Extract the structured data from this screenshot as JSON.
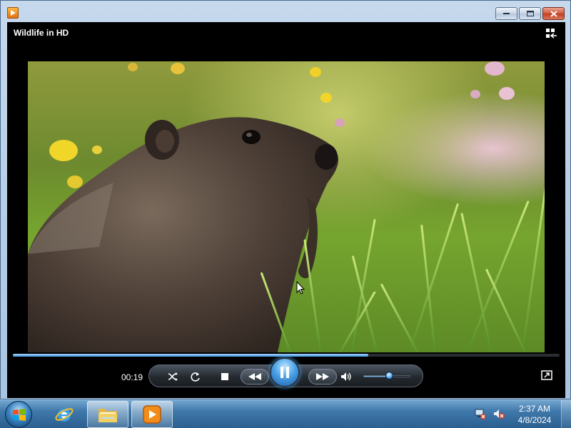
{
  "window": {
    "title": "Wildlife in HD",
    "minimize_icon": "minimize-icon",
    "maximize_icon": "maximize-icon",
    "close_icon": "close-icon"
  },
  "player": {
    "elapsed_time": "00:19",
    "seek_progress": 0.65,
    "volume_level": 0.55,
    "state": "playing",
    "buttons": {
      "shuffle": "shuffle-icon",
      "repeat": "repeat-icon",
      "stop": "stop-icon",
      "previous": "rewind-icon",
      "play_pause": "pause-icon",
      "next": "fast-forward-icon",
      "mute": "speaker-icon",
      "fullscreen": "fullscreen-icon",
      "switch_library": "switch-to-library-icon"
    }
  },
  "taskbar": {
    "items": [
      {
        "name": "Internet Explorer",
        "icon": "internet-explorer-icon"
      },
      {
        "name": "Windows Explorer",
        "icon": "folder-icon"
      },
      {
        "name": "Windows Media Player",
        "icon": "media-player-icon"
      }
    ],
    "tray_icons": [
      "network-icon",
      "volume-muted-icon"
    ],
    "clock": {
      "time": "2:37 AM",
      "date": "4/8/2024"
    }
  },
  "colors": {
    "accent": "#4aa2e8",
    "titlebar": "#b9cfe8",
    "close_button": "#c94a2c"
  }
}
